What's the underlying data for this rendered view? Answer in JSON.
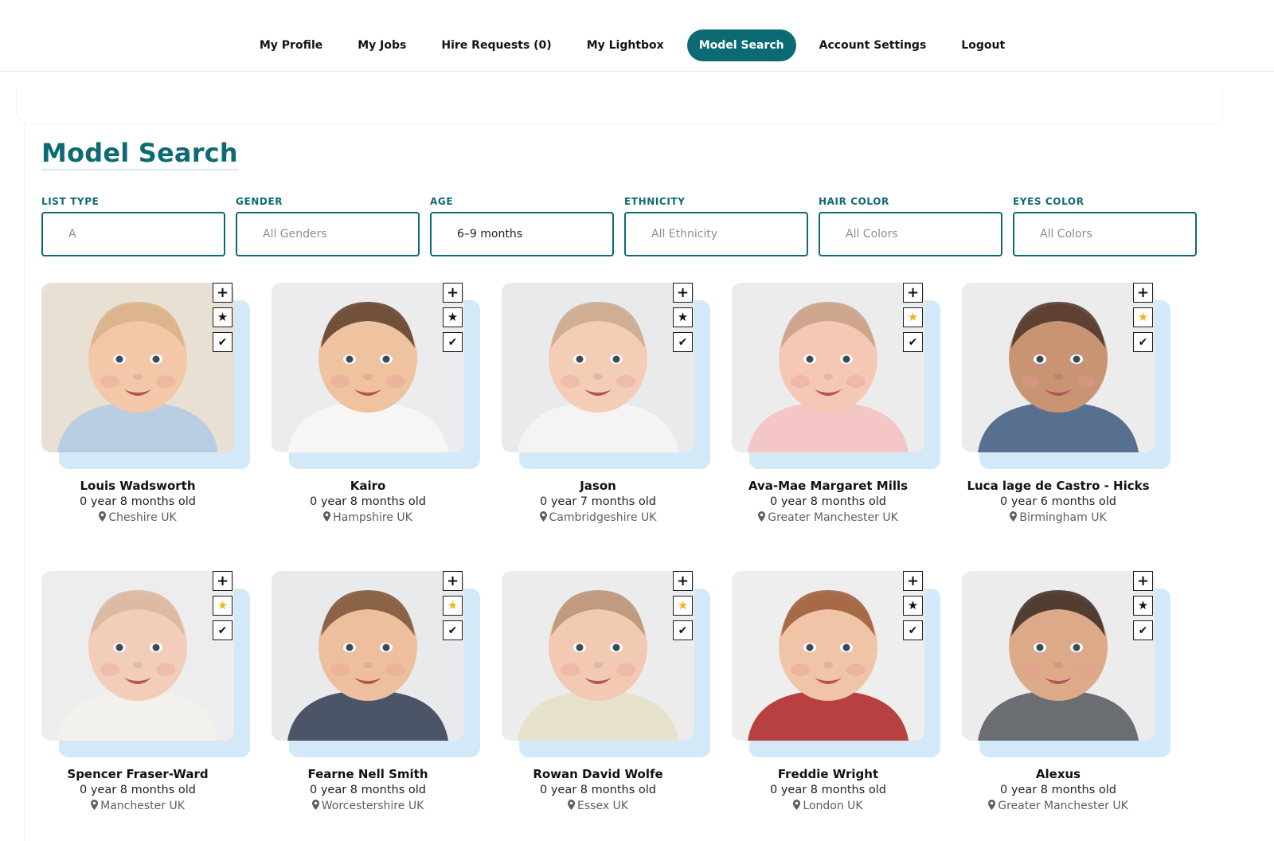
{
  "nav": {
    "items": [
      {
        "label": "My Profile",
        "name": "nav-my-profile",
        "active": false
      },
      {
        "label": "My Jobs",
        "name": "nav-my-jobs",
        "active": false
      },
      {
        "label": "Hire Requests (0)",
        "name": "nav-hire-requests",
        "active": false
      },
      {
        "label": "My Lightbox",
        "name": "nav-my-lightbox",
        "active": false
      },
      {
        "label": "Model Search",
        "name": "nav-model-search",
        "active": true
      },
      {
        "label": "Account Settings",
        "name": "nav-account-settings",
        "active": false
      },
      {
        "label": "Logout",
        "name": "nav-logout",
        "active": false
      }
    ]
  },
  "page": {
    "title": "Model Search"
  },
  "filters": [
    {
      "label": "LIST TYPE",
      "value": "A",
      "filled": false,
      "name": "list-type-select"
    },
    {
      "label": "GENDER",
      "value": "All Genders",
      "filled": false,
      "name": "gender-select"
    },
    {
      "label": "AGE",
      "value": "6–9 months",
      "filled": true,
      "name": "age-select"
    },
    {
      "label": "ETHNICITY",
      "value": "All Ethnicity",
      "filled": false,
      "name": "ethnicity-select"
    },
    {
      "label": "HAIR COLOR",
      "value": "All Colors",
      "filled": false,
      "name": "hair-color-select"
    },
    {
      "label": "EYES COLOR",
      "value": "All Colors",
      "filled": false,
      "name": "eyes-color-select"
    }
  ],
  "icons": {
    "add": "plus-icon",
    "favorite": "star-icon",
    "select": "check-icon",
    "location": "map-pin-icon"
  },
  "colors": {
    "accent": "#0e6a72",
    "card_shadow": "#d3e9f8",
    "favorite_active": "#f2b51c"
  },
  "models": [
    {
      "name": "Louis Wadsworth",
      "age": "0 year 8 months old",
      "location": "Cheshire UK",
      "favorited": false,
      "bg": "#e8e0d2",
      "skin": "#f2c8a8",
      "hair": "#d8b28a",
      "shirt": "#b9cde3"
    },
    {
      "name": "Kairo",
      "age": "0 year 8 months old",
      "location": "Hampshire UK",
      "favorited": false,
      "bg": "#ecebee",
      "skin": "#efc2a0",
      "hair": "#5a3d2a",
      "shirt": "#f6f6f6"
    },
    {
      "name": "Jason",
      "age": "0 year 7 months old",
      "location": "Cambridgeshire UK",
      "favorited": false,
      "bg": "#e9eaec",
      "skin": "#f3cdb6",
      "hair": "#c9a88e",
      "shirt": "#f4f4f4"
    },
    {
      "name": "Ava-Mae Margaret Mills",
      "age": "0 year 8 months old",
      "location": "Greater Manchester UK",
      "favorited": true,
      "bg": "#ececed",
      "skin": "#f4c8b4",
      "hair": "#c79f86",
      "shirt": "#f4c6c6"
    },
    {
      "name": "Luca lage de Castro - Hicks",
      "age": "0 year 6 months old",
      "location": "Birmingham UK",
      "favorited": true,
      "bg": "#ececed",
      "skin": "#c89474",
      "hair": "#4b3328",
      "shirt": "#58708f"
    },
    {
      "name": "Spencer Fraser-Ward",
      "age": "0 year 8 months old",
      "location": "Manchester UK",
      "favorited": true,
      "bg": "#ededee",
      "skin": "#f2cdb9",
      "hair": "#d8b6a0",
      "shirt": "#f3f1ec"
    },
    {
      "name": "Fearne Nell Smith",
      "age": "0 year 8 months old",
      "location": "Worcestershire UK",
      "favorited": true,
      "bg": "#e9eaec",
      "skin": "#eebf9f",
      "hair": "#7a5236",
      "shirt": "#4b5567"
    },
    {
      "name": "Rowan David Wolfe",
      "age": "0 year 8 months old",
      "location": "Essex UK",
      "favorited": true,
      "bg": "#ececed",
      "skin": "#f2c9b2",
      "hair": "#b99276",
      "shirt": "#e7e2cc"
    },
    {
      "name": "Freddie Wright",
      "age": "0 year 8 months old",
      "location": "London UK",
      "favorited": false,
      "bg": "#eeeeef",
      "skin": "#f0c4a6",
      "hair": "#9a5a36",
      "shirt": "#b84040"
    },
    {
      "name": "Alexus",
      "age": "0 year 8 months old",
      "location": "Greater Manchester UK",
      "favorited": false,
      "bg": "#ececed",
      "skin": "#dcaa88",
      "hair": "#3a2a22",
      "shirt": "#6a6d72"
    }
  ]
}
